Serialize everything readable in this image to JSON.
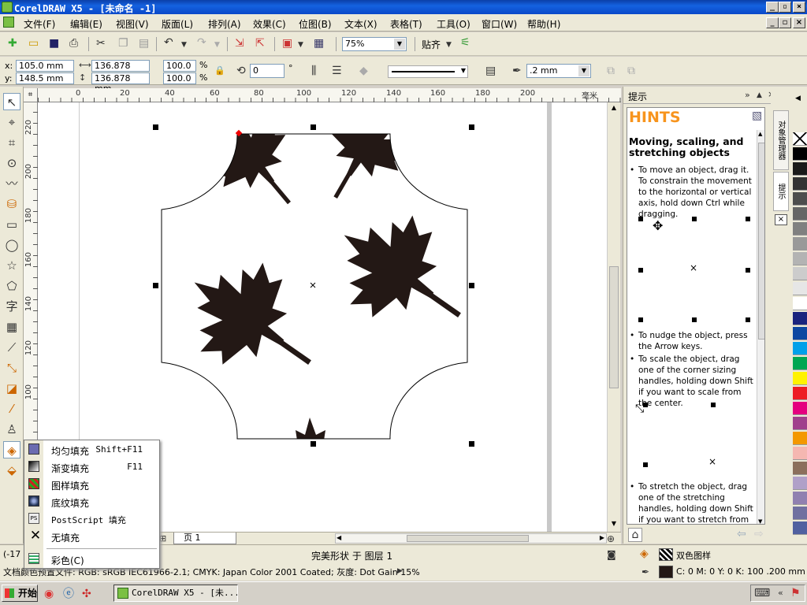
{
  "window": {
    "title": "CorelDRAW X5 - [未命名 -1]"
  },
  "menu": [
    "文件(F)",
    "编辑(E)",
    "视图(V)",
    "版面(L)",
    "排列(A)",
    "效果(C)",
    "位图(B)",
    "文本(X)",
    "表格(T)",
    "工具(O)",
    "窗口(W)",
    "帮助(H)"
  ],
  "toolbar": {
    "zoom": "75%",
    "snap_label": "贴齐"
  },
  "props": {
    "x_label": "x:",
    "x": "105.0 mm",
    "y_label": "y:",
    "y": "148.5 mm",
    "w": "136.878 mm",
    "h": "136.878 mm",
    "sx": "100.0",
    "sy": "100.0",
    "pct": "%",
    "angle": "0",
    "deg": "°",
    "outline": ".2 mm"
  },
  "ruler": {
    "h_ticks": [
      "0",
      "20",
      "40",
      "60",
      "80",
      "100",
      "120",
      "140",
      "160",
      "180",
      "200"
    ],
    "h_unit": "毫米",
    "v_ticks": [
      "220",
      "200",
      "180",
      "160",
      "140",
      "120",
      "100"
    ]
  },
  "flyout": [
    {
      "label": "均匀填充",
      "key": "Shift+F11",
      "icon": "uniform-fill-icon",
      "color": "#6b6bb0"
    },
    {
      "label": "渐变填充",
      "key": "F11",
      "icon": "fountain-fill-icon",
      "color": "#404040"
    },
    {
      "label": "图样填充",
      "key": "",
      "icon": "pattern-fill-icon",
      "color": "#cc2222"
    },
    {
      "label": "底纹填充",
      "key": "",
      "icon": "texture-fill-icon",
      "color": "#3355aa"
    },
    {
      "label": "PostScript 填充",
      "key": "",
      "icon": "postscript-fill-icon",
      "color": "#666666"
    },
    {
      "label": "无填充",
      "key": "",
      "icon": "no-fill-icon",
      "color": "#333333"
    },
    {
      "label": "彩色(C)",
      "key": "",
      "icon": "color-docker-icon",
      "color": "#336699"
    }
  ],
  "status": {
    "coords": "(-17",
    "object": "完美形状 于 图层 1",
    "doc_info": "文档颜色预置文件: RGB: sRGB IEC61966-2.1; CMYK: Japan Color 2001 Coated; 灰度: Dot Gain 15%",
    "fill": "双色图样",
    "outline": "C: 0 M: 0 Y: 0 K: 100  .200 mm"
  },
  "page_tab": "页 1",
  "docker": {
    "title": "提示",
    "hints_header": "HINTS",
    "heading": "Moving, scaling, and stretching objects",
    "p1": "To move an object, drag it. To constrain the movement to the horizontal or vertical axis, hold down Ctrl while dragging.",
    "p2": "To nudge the object, press the Arrow keys.",
    "p3": "To scale the object, drag one of the corner sizing handles, holding down Shift if you want to scale from the center.",
    "p4": "To stretch the object, drag one of the stretching handles, holding down Shift if you want to stretch from the"
  },
  "vtabs": [
    "对象管理器",
    "提示"
  ],
  "palette": [
    "#ffffff",
    "#000000",
    "#1a1a1a",
    "#333333",
    "#4d4d4d",
    "#666666",
    "#808080",
    "#999999",
    "#b3b3b3",
    "#cccccc",
    "#e6e6e6",
    "#ffffff",
    "#1a237e",
    "#0d47a1",
    "#00a0e9",
    "#00a651",
    "#fff200",
    "#ed1c24",
    "#e4007f",
    "#a0408c",
    "#f39800",
    "#f5b7b1",
    "#8b6f5c",
    "#b0a0c8",
    "#9080b0",
    "#7070a0",
    "#5060a0"
  ],
  "taskbar": {
    "start": "开始",
    "task": "CorelDRAW X5 - [未..."
  },
  "colors": {
    "accent": "#f7941d",
    "title": "#0a48c8",
    "leaf": "#231815"
  }
}
